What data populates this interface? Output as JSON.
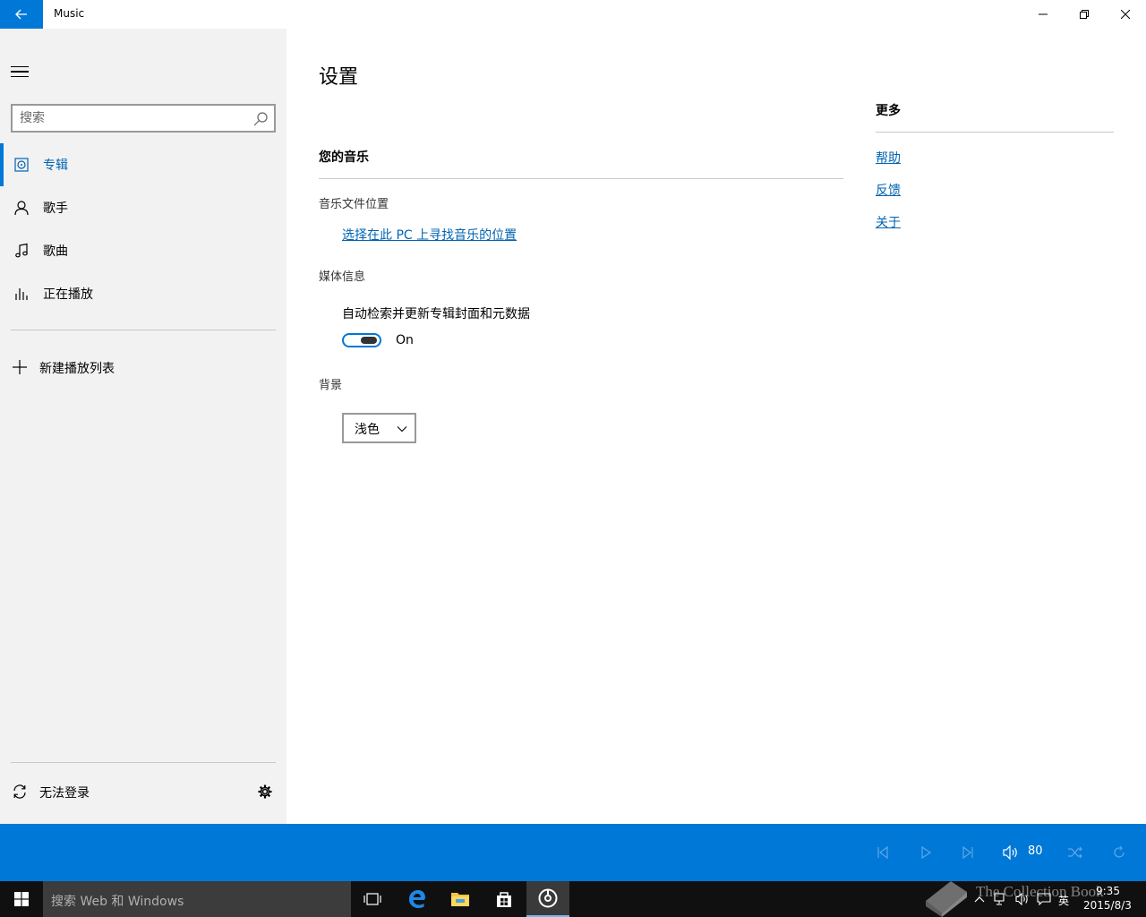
{
  "window": {
    "title": "Music"
  },
  "sidebar": {
    "search_placeholder": "搜索",
    "items": [
      {
        "label": "专辑",
        "icon": "album-icon",
        "active": true
      },
      {
        "label": "歌手",
        "icon": "artist-icon",
        "active": false
      },
      {
        "label": "歌曲",
        "icon": "music-note-icon",
        "active": false
      },
      {
        "label": "正在播放",
        "icon": "now-playing-icon",
        "active": false
      }
    ],
    "new_playlist": "新建播放列表",
    "signin": "无法登录"
  },
  "main": {
    "title": "设置",
    "your_music": {
      "heading": "您的音乐",
      "location_label": "音乐文件位置",
      "location_link": "选择在此 PC 上寻找音乐的位置"
    },
    "media_info": {
      "label": "媒体信息",
      "description": "自动检索并更新专辑封面和元数据",
      "toggle_state": "On"
    },
    "background": {
      "label": "背景",
      "selected": "浅色"
    },
    "more": {
      "heading": "更多",
      "links": [
        "帮助",
        "反馈",
        "关于"
      ]
    }
  },
  "playbar": {
    "volume": "80"
  },
  "taskbar": {
    "search_text": "搜索 Web 和 Windows",
    "time": "9:35",
    "date": "2015/8/3",
    "ime": "英",
    "watermark": "The Collection Book"
  },
  "colors": {
    "accent": "#0078d7",
    "link": "#0063b1",
    "sidebar_bg": "#f2f2f2",
    "taskbar_bg": "#101010"
  }
}
